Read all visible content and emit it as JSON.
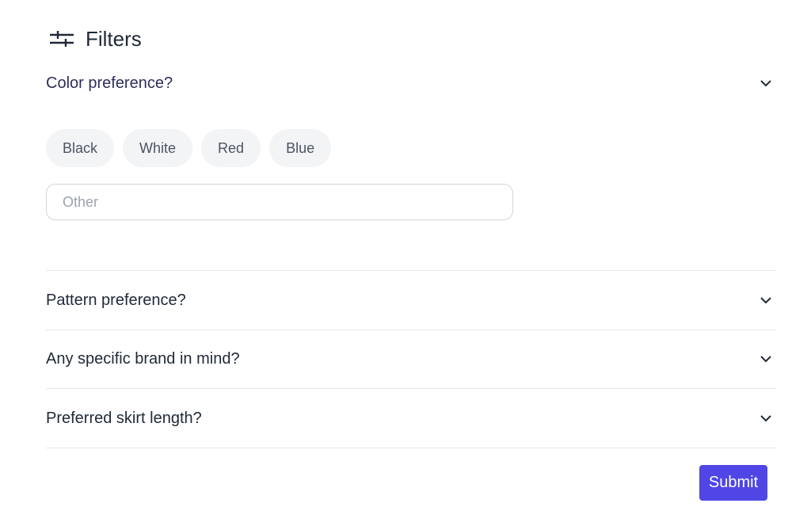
{
  "header": {
    "title": "Filters",
    "icon": "sliders-icon"
  },
  "sections": [
    {
      "question": "Color preference?",
      "expanded": true
    },
    {
      "question": "Pattern preference?",
      "expanded": false
    },
    {
      "question": "Any specific brand in mind?",
      "expanded": false
    },
    {
      "question": "Preferred skirt length?",
      "expanded": false
    }
  ],
  "color_options": [
    "Black",
    "White",
    "Red",
    "Blue"
  ],
  "other_input": {
    "placeholder": "Other",
    "value": ""
  },
  "submit_label": "Submit",
  "colors": {
    "accent": "#4f46e5",
    "chip_bg": "#f3f4f6",
    "active_question": "#2e2f5f"
  }
}
